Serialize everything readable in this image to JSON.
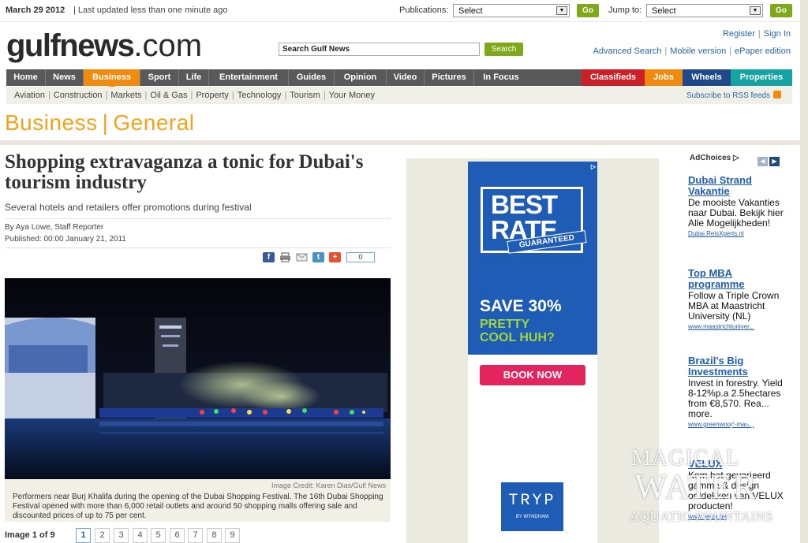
{
  "topbar": {
    "date": "March 29 2012",
    "updated": "| Last updated less than one minute ago",
    "publications_label": "Publications:",
    "publications_value": "Select",
    "jump_label": "Jump to:",
    "jump_value": "Select",
    "go_label": "Go"
  },
  "masthead": {
    "logo_name": "gulfnews",
    "logo_suffix": ".com",
    "search_placeholder": "Search Gulf News",
    "search_button": "Search",
    "register": "Register",
    "sign_in": "Sign In",
    "advanced_search": "Advanced Search",
    "mobile_version": "Mobile version",
    "epaper": "ePaper edition"
  },
  "mainnav": {
    "items": [
      "Home",
      "News",
      "Business",
      "Sport",
      "Life",
      "Entertainment",
      "Guides",
      "Opinion",
      "Video",
      "Pictures",
      "In Focus"
    ],
    "active": "Business",
    "right_items": [
      "Classifieds",
      "Jobs",
      "Wheels",
      "Properties"
    ],
    "colors": {
      "bar": "#595959",
      "active": "#f18b0f",
      "classifieds": "#cc1f26",
      "jobs": "#f18b0f",
      "wheels": "#1e4a8a",
      "properties": "#16a3a3"
    }
  },
  "subnav": {
    "items": [
      "Aviation",
      "Construction",
      "Markets",
      "Oil & Gas",
      "Property",
      "Technology",
      "Tourism",
      "Your Money"
    ],
    "rss": "Subscribe to RSS feeds"
  },
  "section": {
    "name": "Business",
    "sub": "General"
  },
  "article": {
    "headline": "Shopping extravaganza a tonic for Dubai's tourism industry",
    "standfirst": "Several hotels and retailers offer promotions during festival",
    "byline": "By Aya Lowe, Staff Reporter",
    "published": "Published: 00:00 January 21, 2011",
    "share_count": "0",
    "share_icons": [
      "facebook-icon",
      "print-icon",
      "email-icon",
      "twitter-icon",
      "add-icon"
    ],
    "image_credit": "Image Credit: Karen Dias/Gulf News",
    "caption": "Performers near Burj Khalifa during the opening of the Dubai Shopping Festival. The 16th Dubai Shopping Festival opened with more than 6,000 retail outlets and around 50 shopping malls offering sale and discounted prices of up to 75 per cent.",
    "image_count": "Image 1 of 9",
    "pages": [
      "1",
      "2",
      "3",
      "4",
      "5",
      "6",
      "7",
      "8",
      "9"
    ],
    "current_page": "1"
  },
  "ad_banner": {
    "best": "BEST",
    "rate": "RATE",
    "guaranteed": "GUARANTEED",
    "save": "SAVE 30%",
    "pretty": "PRETTY",
    "cool": "COOL HUH?",
    "book_now": "BOOK NOW",
    "brand": "TRYP",
    "brand_sub": "BY WYNDHAM",
    "colors": {
      "blue": "#1f5cb5",
      "green": "#9fd63a",
      "pink": "#e2255f"
    }
  },
  "sponsored": {
    "adchoices": "AdChoices",
    "links": [
      {
        "title": "Dubai Strand Vakantie",
        "body": "De mooiste Vakanties naar Dubai. Bekijk hier Alle Mogelijkheden!",
        "url": "Dubai.ReisXperts.nl"
      },
      {
        "title": "Top MBA programme",
        "body": "Follow a Triple Crown MBA at Maastricht University (NL)",
        "url": "www.maastrichtuniver..."
      },
      {
        "title": "Brazil's Big Investments",
        "body": "Invest in forestry. Yield 8-12%p.a 2.5hectares from €8,570. Rea... more.",
        "url": "www.greenwood-man..."
      },
      {
        "title": "VELUX",
        "body": "Kom het gevarieerd gamma & design ontdekken van VELUX producten!",
        "url": "www.velux.be"
      }
    ]
  },
  "watermark": {
    "line1": "MAGICAL",
    "line2": "WATER",
    "line3": "AQUATIC FOUNTAINS"
  }
}
